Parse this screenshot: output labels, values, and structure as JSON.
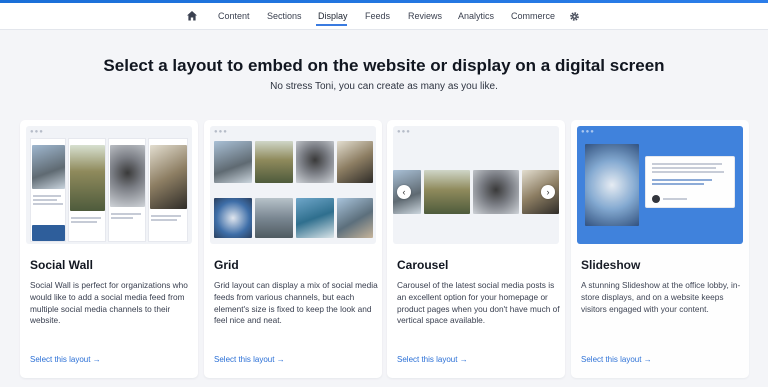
{
  "nav": {
    "items": [
      {
        "label": "Content"
      },
      {
        "label": "Sections"
      },
      {
        "label": "Display"
      },
      {
        "label": "Feeds"
      },
      {
        "label": "Reviews"
      },
      {
        "label": "Analytics"
      },
      {
        "label": "Commerce"
      }
    ],
    "active": "Display",
    "icons": [
      "home-icon",
      "gear-icon"
    ]
  },
  "page": {
    "title": "Select a layout to embed on the website or display on a digital screen",
    "subtitle": "No stress Toni, you can create as many as you like."
  },
  "cards": [
    {
      "title": "Social Wall",
      "description": "Social Wall is perfect for organizations who would like to add a social media feed from multiple social media channels to their website.",
      "link": "Select this layout →"
    },
    {
      "title": "Grid",
      "description": "Grid layout can display a mix of social media feeds from various channels, but each element's size is fixed to keep the look and feel nice and neat.",
      "link": "Select this layout →"
    },
    {
      "title": "Carousel",
      "description": "Carousel of the latest social media posts is an excellent option for your homepage or product pages when you don't have much of vertical space available.",
      "link": "Select this layout →"
    },
    {
      "title": "Slideshow",
      "description": "A stunning Slideshow at the office lobby, in-store displays, and on a website keeps visitors engaged with your content.",
      "link": "Select this layout →"
    }
  ],
  "colors": {
    "accent": "#2a6fd6",
    "slideshow_bg": "#3b7fdc",
    "heading": "#111620"
  }
}
